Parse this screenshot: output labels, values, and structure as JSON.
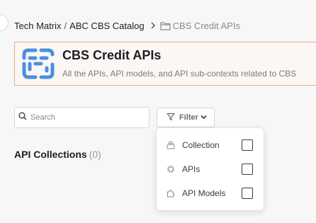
{
  "breadcrumb": {
    "root": "Tech Matrix",
    "separator": "/",
    "catalog": "ABC CBS Catalog",
    "current": "CBS Credit APIs"
  },
  "banner": {
    "title": "CBS Credit APIs",
    "subtitle": "All the APIs, API models, and API sub-contexts related to CBS",
    "logo_color": "#4a90e2"
  },
  "search": {
    "placeholder": "Search",
    "value": ""
  },
  "filter": {
    "label": "Filter"
  },
  "section": {
    "title": "API Collections",
    "count": "(0)"
  },
  "filter_menu": {
    "items": [
      {
        "label": "Collection",
        "icon": "collection-icon",
        "checked": false
      },
      {
        "label": "APIs",
        "icon": "chip-icon",
        "checked": false
      },
      {
        "label": "API Models",
        "icon": "puzzle-icon",
        "checked": false
      }
    ]
  },
  "colors": {
    "accent_border": "#f0a58a",
    "logo": "#4a90e2"
  }
}
